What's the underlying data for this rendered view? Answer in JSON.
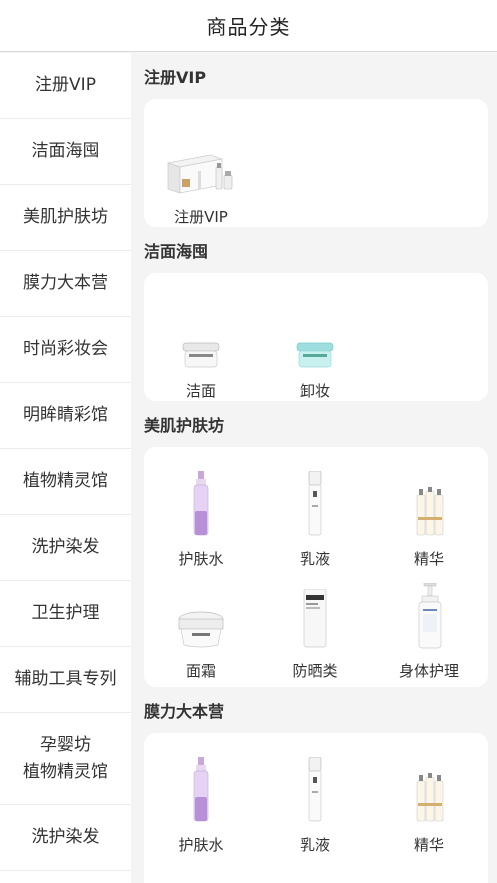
{
  "header": {
    "title": "商品分类"
  },
  "sidebar": {
    "items": [
      {
        "label": "注册VIP"
      },
      {
        "label": "洁面海囤"
      },
      {
        "label": "美肌护肤坊"
      },
      {
        "label": "膜力大本营"
      },
      {
        "label": "时尚彩妆会"
      },
      {
        "label": "明眸睛彩馆"
      },
      {
        "label": "植物精灵馆"
      },
      {
        "label": "洗护染发"
      },
      {
        "label": "卫生护理"
      },
      {
        "label": "辅助工具专列"
      },
      {
        "label_line1": "孕婴坊",
        "label_line2": "植物精灵馆"
      },
      {
        "label": "洗护染发"
      }
    ]
  },
  "sections": [
    {
      "title": "注册VIP",
      "products": [
        {
          "name": "注册VIP",
          "icon": "gift-set-icon"
        }
      ]
    },
    {
      "title": "洁面海囤",
      "products": [
        {
          "name": "洁面",
          "icon": "cleanser-jar-icon"
        },
        {
          "name": "卸妆",
          "icon": "remover-jar-icon"
        }
      ]
    },
    {
      "title": "美肌护肤坊",
      "products": [
        {
          "name": "护肤水",
          "icon": "toner-bottle-icon"
        },
        {
          "name": "乳液",
          "icon": "lotion-bottle-icon"
        },
        {
          "name": "精华",
          "icon": "serum-bottles-icon"
        },
        {
          "name": "面霜",
          "icon": "cream-jar-icon"
        },
        {
          "name": "防晒类",
          "icon": "sunscreen-tube-icon"
        },
        {
          "name": "身体护理",
          "icon": "pump-bottle-icon"
        }
      ]
    },
    {
      "title": "膜力大本营",
      "products": [
        {
          "name": "护肤水",
          "icon": "toner-bottle-icon"
        },
        {
          "name": "乳液",
          "icon": "lotion-bottle-icon"
        },
        {
          "name": "精华",
          "icon": "serum-bottles-icon"
        }
      ]
    }
  ]
}
